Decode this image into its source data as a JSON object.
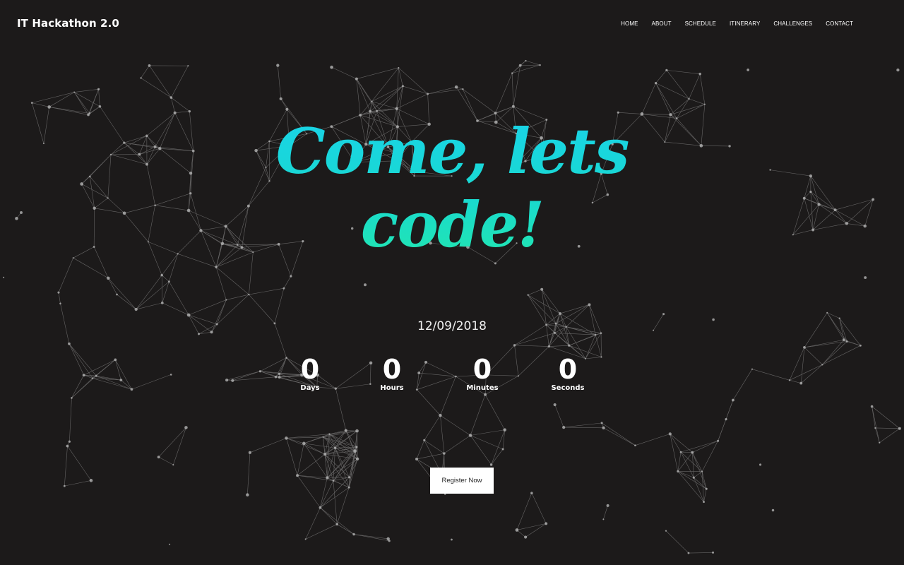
{
  "brand": {
    "name": "IT Hackathon 2.0"
  },
  "nav": {
    "items": [
      "HOME",
      "ABOUT",
      "SCHEDULE",
      "ITINERARY",
      "CHALLENGES",
      "CONTACT"
    ]
  },
  "hero": {
    "title_line1": "Come, lets",
    "title_line2": "code!",
    "date": "12/09/2018",
    "title_colors": [
      "#19d3e8",
      "#21e6b0"
    ]
  },
  "countdown": {
    "days": {
      "value": "0",
      "label": "Days"
    },
    "hours": {
      "value": "0",
      "label": "Hours"
    },
    "minutes": {
      "value": "0",
      "label": "Minutes"
    },
    "seconds": {
      "value": "0",
      "label": "Seconds"
    }
  },
  "cta": {
    "register_label": "Register Now"
  },
  "theme": {
    "background": "#1c1a1a",
    "network_color": "#bdbdbd"
  }
}
